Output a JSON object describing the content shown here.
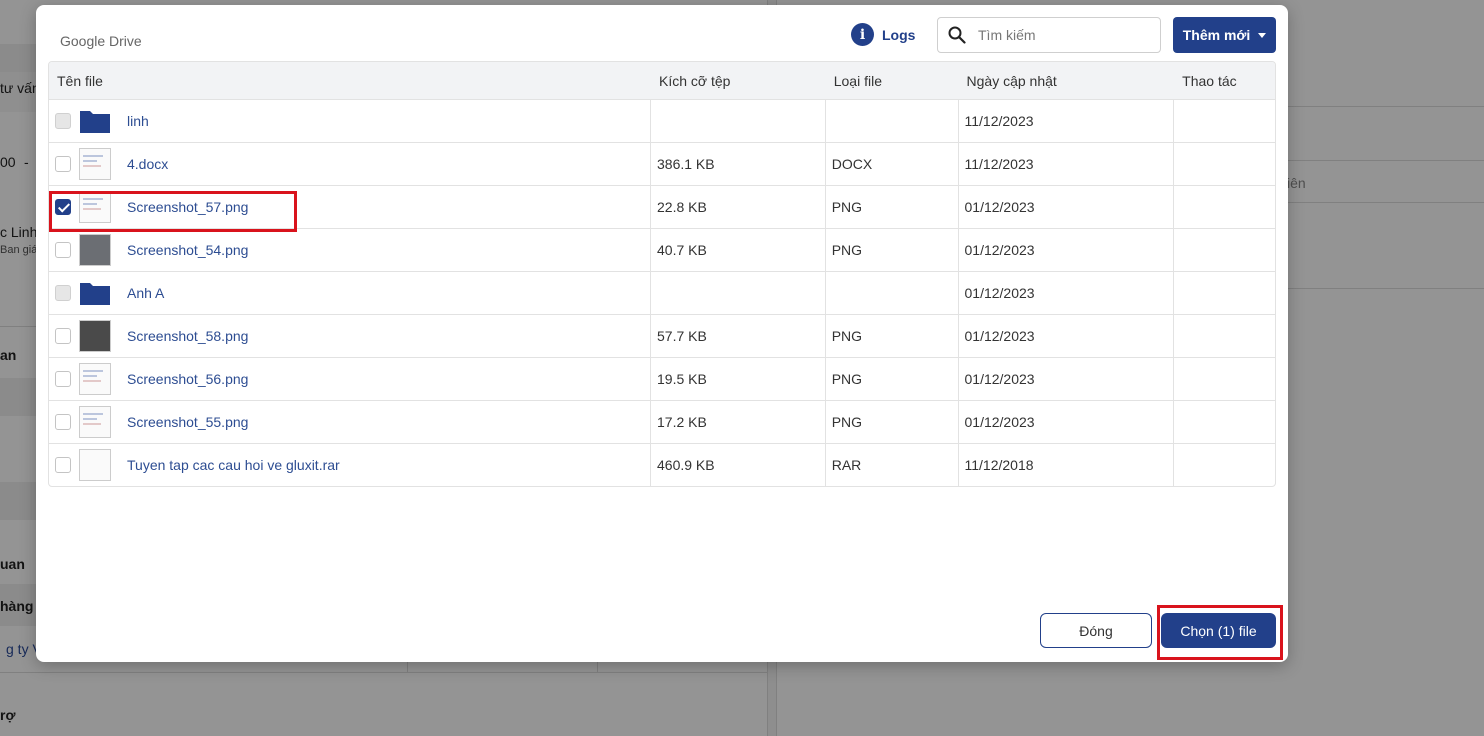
{
  "background": {
    "fragments": [
      "tư vấn",
      "00",
      "-",
      "c Linh",
      "Ban giá",
      "an",
      "uan",
      "hàng",
      "g ty Vie",
      "rợ",
      "iên"
    ]
  },
  "modal": {
    "title": "Google Drive",
    "logs_label": "Logs",
    "search": {
      "placeholder": "Tìm kiếm",
      "value": ""
    },
    "add_button_label": "Thêm mới",
    "columns": [
      "Tên file",
      "Kích cỡ tệp",
      "Loại file",
      "Ngày cập nhật",
      "Thao tác"
    ],
    "rows": [
      {
        "name": "linh",
        "size": "",
        "type": "",
        "date": "11/12/2023",
        "kind": "folder",
        "checked": false
      },
      {
        "name": "4.docx",
        "size": "386.1 KB",
        "type": "DOCX",
        "date": "11/12/2023",
        "kind": "doc",
        "checked": false
      },
      {
        "name": "Screenshot_57.png",
        "size": "22.8 KB",
        "type": "PNG",
        "date": "01/12/2023",
        "kind": "image",
        "checked": true
      },
      {
        "name": "Screenshot_54.png",
        "size": "40.7 KB",
        "type": "PNG",
        "date": "01/12/2023",
        "kind": "image-map",
        "checked": false
      },
      {
        "name": "Anh A",
        "size": "",
        "type": "",
        "date": "01/12/2023",
        "kind": "folder",
        "checked": false
      },
      {
        "name": "Screenshot_58.png",
        "size": "57.7 KB",
        "type": "PNG",
        "date": "01/12/2023",
        "kind": "image-dark",
        "checked": false
      },
      {
        "name": "Screenshot_56.png",
        "size": "19.5 KB",
        "type": "PNG",
        "date": "01/12/2023",
        "kind": "image",
        "checked": false
      },
      {
        "name": "Screenshot_55.png",
        "size": "17.2 KB",
        "type": "PNG",
        "date": "01/12/2023",
        "kind": "image",
        "checked": false
      },
      {
        "name": "Tuyen tap cac cau hoi ve gluxit.rar",
        "size": "460.9 KB",
        "type": "RAR",
        "date": "11/12/2018",
        "kind": "blank",
        "checked": false
      }
    ],
    "close_button_label": "Đóng",
    "choose_button_label": "Chọn (1) file"
  },
  "colors": {
    "primary": "#22408a",
    "link": "#2d4d92",
    "highlight": "#d9131c"
  },
  "icons": [
    "info-icon",
    "search-icon",
    "caret-down-icon",
    "folder-icon",
    "checkbox-icon"
  ]
}
